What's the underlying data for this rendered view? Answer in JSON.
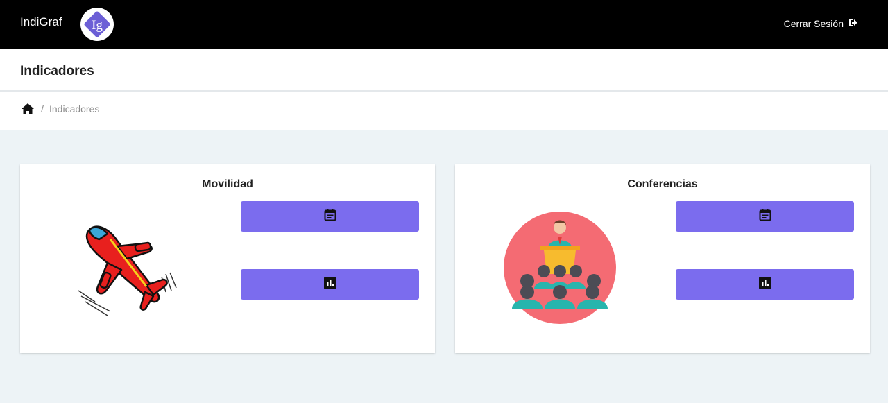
{
  "app": {
    "brand": "IndiGraf",
    "logo_text": "Ig",
    "logout_label": "Cerrar Sesión",
    "logout_icon": "sign-out-icon"
  },
  "header": {
    "title": "Indicadores"
  },
  "breadcrumb": {
    "home_icon": "home-icon",
    "separator": "/",
    "current": "Indicadores"
  },
  "cards": [
    {
      "title": "Movilidad",
      "image": "airplane-illustration",
      "buttons": [
        {
          "icon": "calendar-icon"
        },
        {
          "icon": "bar-chart-icon"
        }
      ]
    },
    {
      "title": "Conferencias",
      "image": "conference-speaker-illustration",
      "buttons": [
        {
          "icon": "calendar-icon"
        },
        {
          "icon": "bar-chart-icon"
        }
      ]
    }
  ],
  "colors": {
    "navbar": "#000000",
    "accent_button": "#7b6cee",
    "background": "#edf3f6",
    "logo_purple": "#6c5fd6"
  }
}
